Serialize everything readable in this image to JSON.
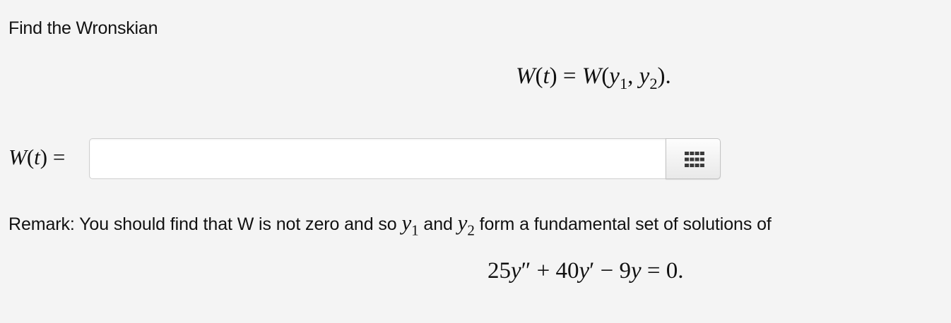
{
  "problem": {
    "title": "Find the Wronskian",
    "display_eq": {
      "lhs_fn": "W",
      "lhs_var": "t",
      "rhs_fn": "W",
      "y": "y",
      "sub1": "1",
      "sub2": "2"
    },
    "answer": {
      "label_fn": "W",
      "label_var": "t",
      "value": "",
      "placeholder": ""
    },
    "keypad_icon": "keypad-grid-icon",
    "remark": {
      "part1": "Remark: You should find that W is not zero and so ",
      "y": "y",
      "sub1": "1",
      "part2": " and ",
      "sub2": "2",
      "part3": " form a fundamental set of solutions of"
    },
    "ode": {
      "coef1": "25",
      "coef2": "40",
      "coef3": "9",
      "var": "y",
      "rhs": "0"
    }
  }
}
